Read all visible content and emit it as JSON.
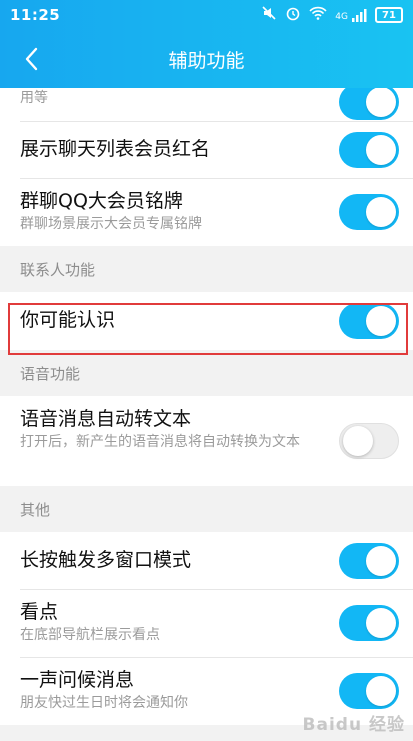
{
  "status": {
    "time": "11:25",
    "signal_text": "4G",
    "battery": "71"
  },
  "header": {
    "title": "辅助功能"
  },
  "sections": {
    "top_partial_sub": "用等",
    "display": {
      "items": [
        {
          "title": "展示聊天列表会员红名",
          "toggle": "on"
        },
        {
          "title": "群聊QQ大会员铭牌",
          "sub": "群聊场景展示大会员专属铭牌",
          "toggle": "on"
        }
      ]
    },
    "contacts": {
      "header": "联系人功能",
      "items": [
        {
          "title": "你可能认识",
          "toggle": "on"
        }
      ]
    },
    "voice": {
      "header": "语音功能",
      "items": [
        {
          "title": "语音消息自动转文本",
          "sub": "打开后，新产生的语音消息将自动转换为文本",
          "toggle": "off"
        }
      ]
    },
    "other": {
      "header": "其他",
      "items": [
        {
          "title": "长按触发多窗口模式",
          "toggle": "on"
        },
        {
          "title": "看点",
          "sub": "在底部导航栏展示看点",
          "toggle": "on"
        },
        {
          "title": "一声问候消息",
          "sub": "朋友快过生日时将会通知你",
          "toggle": "on"
        }
      ]
    }
  },
  "watermark": "Baidu 经验"
}
